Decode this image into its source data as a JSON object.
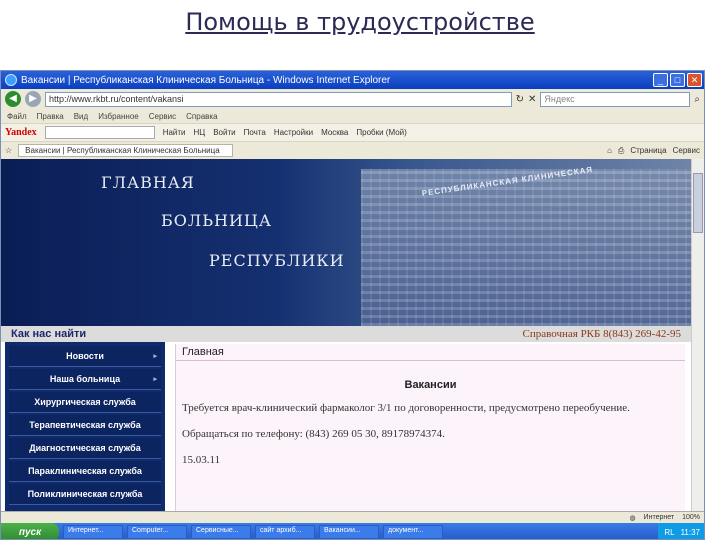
{
  "slide": {
    "title": "Помощь в трудоустройстве"
  },
  "window": {
    "title": "Вакансии | Республиканская Клиническая Больница - Windows Internet Explorer"
  },
  "address": {
    "url": "http://www.rkbt.ru/content/vakansi",
    "search_placeholder": "Яндекс"
  },
  "menu": [
    "Файл",
    "Правка",
    "Вид",
    "Избранное",
    "Сервис",
    "Справка"
  ],
  "yandex": {
    "logo": "Yandex",
    "find": "Найти",
    "nc": "НЦ",
    "enter": "Войти",
    "mail": "Почта",
    "settings": "Настройки",
    "weather": "Москва",
    "traffic": "Пробки (Мой)"
  },
  "tab": {
    "label": "Вакансии | Республиканская Клиническая Больница",
    "page": "Страница",
    "service": "Сервис"
  },
  "banner": {
    "line1": "ГЛАВНАЯ",
    "line2": "БОЛЬНИЦА",
    "line3": "РЕСПУБЛИКИ",
    "sign": "РЕСПУБЛИКАНСКАЯ КЛИНИЧЕСКАЯ"
  },
  "navbar": {
    "how": "Как нас найти",
    "ref": "Справочная РКБ 8(843) 269-42-95"
  },
  "sidebar": {
    "items": [
      "Новости",
      "Наша больница",
      "Хирургическая служба",
      "Терапевтическая служба",
      "Диагностическая служба",
      "Параклиническая служба",
      "Поликлиническая служба"
    ]
  },
  "main": {
    "crumb": "Главная",
    "title": "Вакансии",
    "text1": "Требуется врач-клинический фармаколог 3/1 по договоренности, предусмотрено переобучение.",
    "text2": "Обращаться по телефону: (843) 269 05 30, 89178974374.",
    "date": "15.03.11"
  },
  "statusbar": {
    "zone": "Интернет",
    "zoom": "100%"
  },
  "taskbar": {
    "start": "пуск",
    "items": [
      "Интернет...",
      "Computer...",
      "Сервисные...",
      "сайт архиб...",
      "Вакансии...",
      "документ..."
    ],
    "lang": "RL",
    "time": "11:37"
  },
  "colors": {
    "banner": "#0a1d55",
    "sidebar": "#0f2b6b",
    "main_bg": "#fdf3fa",
    "titlebar": "#0a3ec0"
  }
}
